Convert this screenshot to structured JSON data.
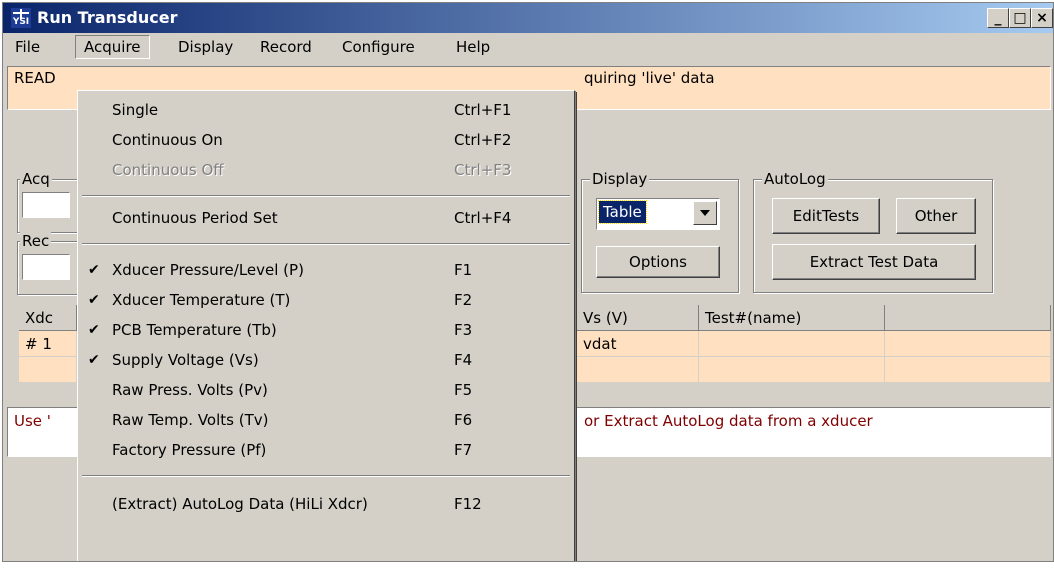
{
  "window": {
    "title": "Run Transducer",
    "icon_name": "ysi-app-icon",
    "controls": [
      "_",
      "□",
      "×"
    ]
  },
  "menubar": [
    "File",
    "Acquire",
    "Display",
    "Record",
    "Configure",
    "Help"
  ],
  "status_top": {
    "left_text": "READ",
    "right_text": "quiring 'live' data"
  },
  "left_groups": [
    {
      "label": "Acq"
    },
    {
      "label": "Rec"
    }
  ],
  "display_group": {
    "label": "Display",
    "combo_value": "Table",
    "options_button": "Options"
  },
  "autolog_group": {
    "label": "AutoLog",
    "edit_button": "EditTests",
    "other_button": "Other",
    "extract_button": "Extract Test Data"
  },
  "grid": {
    "left_header": "Xdc",
    "left_row": "# 1",
    "headers": [
      "Vs (V)",
      "Test#(name)",
      ""
    ],
    "row1": [
      "vdat",
      "",
      ""
    ],
    "row2": [
      "",
      "",
      ""
    ]
  },
  "status_bottom": {
    "left_text": "Use '",
    "right_text": "or Extract AutoLog data from a xducer"
  },
  "acquire_menu": [
    {
      "label": "Single",
      "shortcut": "Ctrl+F1",
      "checked": false,
      "disabled": false
    },
    {
      "label": "Continuous On",
      "shortcut": "Ctrl+F2",
      "checked": false,
      "disabled": false
    },
    {
      "label": "Continuous Off",
      "shortcut": "Ctrl+F3",
      "checked": false,
      "disabled": true
    },
    {
      "label": "Continuous Period Set",
      "shortcut": "Ctrl+F4",
      "checked": false,
      "disabled": false
    },
    {
      "label": "Xducer Pressure/Level (P)",
      "shortcut": "F1",
      "checked": true,
      "disabled": false
    },
    {
      "label": "Xducer Temperature (T)",
      "shortcut": "F2",
      "checked": true,
      "disabled": false
    },
    {
      "label": "PCB Temperature (Tb)",
      "shortcut": "F3",
      "checked": true,
      "disabled": false
    },
    {
      "label": "Supply Voltage (Vs)",
      "shortcut": "F4",
      "checked": true,
      "disabled": false
    },
    {
      "label": "Raw Press. Volts (Pv)",
      "shortcut": "F5",
      "checked": false,
      "disabled": false
    },
    {
      "label": "Raw Temp. Volts (Tv)",
      "shortcut": "F6",
      "checked": false,
      "disabled": false
    },
    {
      "label": "Factory Pressure (Pf)",
      "shortcut": "F7",
      "checked": false,
      "disabled": false
    },
    {
      "label": "(Extract) AutoLog Data (HiLi Xdcr)",
      "shortcut": "F12",
      "checked": false,
      "disabled": false
    }
  ],
  "check_glyph": "✔",
  "colors": {
    "title_start": "#0a246a",
    "title_end": "#a6caf0",
    "panel": "#d4d0c8",
    "status_bg": "#ffe0c0",
    "status_text": "#800000"
  }
}
